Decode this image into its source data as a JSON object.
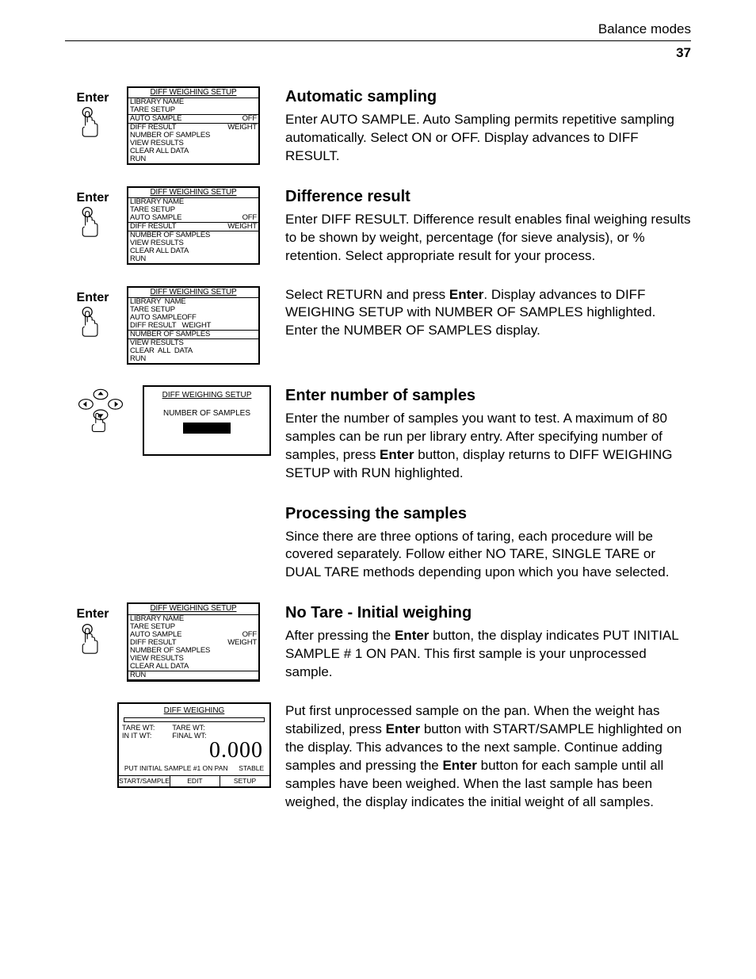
{
  "header": {
    "section": "Balance modes",
    "page": "37"
  },
  "enterLabel": "Enter",
  "sections": [
    {
      "heading": "Automatic sampling",
      "body": "Enter AUTO SAMPLE. Auto Sampling permits repetitive sampling automatically. Select ON or OFF. Display advances to DIFF RESULT."
    },
    {
      "heading": "Difference result",
      "body": "Enter DIFF RESULT. Difference result enables final weighing results to be shown by weight, percentage (for sieve analysis), or % retention. Select appropriate result for your process."
    },
    {
      "heading": "",
      "body_pre": "Select RETURN and press ",
      "body_bold": "Enter",
      "body_post": ". Display advances to DIFF WEIGHING SETUP with NUMBER OF SAMPLES highlighted. Enter the NUMBER OF SAMPLES display."
    },
    {
      "heading": "Enter number of samples",
      "body_pre": "Enter the number of samples you want to test. A maximum of 80 samples can be run per library entry. After specifying number of samples, press ",
      "body_bold": "Enter",
      "body_post": " button, display returns to DIFF WEIGHING SETUP with RUN highlighted."
    },
    {
      "heading": "Processing the samples",
      "body": "Since there are three options of taring, each procedure will be covered separately. Follow either NO TARE, SINGLE TARE or DUAL TARE methods depending upon which you have selected."
    },
    {
      "heading": "No Tare - Initial weighing",
      "body_pre": "After pressing the ",
      "body_bold": "Enter",
      "body_post": " button, the display indicates PUT INITIAL SAMPLE # 1 ON PAN. This first sample is your unprocessed sample."
    },
    {
      "heading": "",
      "body_parts": [
        "Put first unprocessed sample on the pan. When the weight has stabilized, press ",
        "Enter",
        " button with START/SAMPLE highlighted on the display. This advances to the next sample. Continue adding samples and pressing the ",
        "Enter",
        " button for each sample until all samples have been weighed. When the last sample has been weighed, the display indicates the initial weight of all samples."
      ]
    }
  ],
  "screens": {
    "title": "DIFF WEIGHING SETUP",
    "menu1": {
      "lines": [
        {
          "l": "LIBRARY NAME"
        },
        {
          "l": "TARE SETUP"
        },
        {
          "l": "AUTO SAMPLE",
          "r": "OFF",
          "sel": true
        },
        {
          "l": "DIFF RESULT",
          "r": "WEIGHT"
        },
        {
          "l": "NUMBER OF SAMPLES"
        },
        {
          "l": "VIEW RESULTS"
        },
        {
          "l": "CLEAR ALL DATA"
        },
        {
          "l": "RUN"
        }
      ]
    },
    "menu2": {
      "lines": [
        {
          "l": "LIBRARY NAME"
        },
        {
          "l": "TARE SETUP"
        },
        {
          "l": "AUTO SAMPLE",
          "r": "OFF"
        },
        {
          "l": "DIFF RESULT",
          "r": "WEIGHT",
          "sel": true
        },
        {
          "l": "NUMBER OF SAMPLES"
        },
        {
          "l": "VIEW RESULTS"
        },
        {
          "l": "CLEAR ALL DATA"
        },
        {
          "l": "RUN"
        }
      ]
    },
    "menu3": {
      "lines": [
        {
          "l": "LIBRARY  NAME"
        },
        {
          "l": "TARE SETUP"
        },
        {
          "l": "AUTO SAMPLEOFF"
        },
        {
          "l": "DIFF RESULT   WEIGHT"
        },
        {
          "l": "NUMBER OF SAMPLES",
          "sel": true
        },
        {
          "l": "VIEW RESULTS"
        },
        {
          "l": "CLEAR  ALL  DATA"
        },
        {
          "l": "RUN"
        }
      ]
    },
    "numEntry": {
      "title": "DIFF WEIGHING SETUP",
      "label": "NUMBER OF SAMPLES"
    },
    "menu5": {
      "lines": [
        {
          "l": "LIBRARY NAME"
        },
        {
          "l": "TARE SETUP"
        },
        {
          "l": "AUTO SAMPLE",
          "r": "OFF"
        },
        {
          "l": "DIFF RESULT",
          "r": "WEIGHT"
        },
        {
          "l": "NUMBER OF SAMPLES"
        },
        {
          "l": "VIEW RESULTS"
        },
        {
          "l": "CLEAR ALL DATA"
        },
        {
          "l": "RUN",
          "sel": true
        }
      ]
    },
    "weigh": {
      "title": "DIFF WEIGHING",
      "left": [
        "TARE WT:",
        "IN IT WT:"
      ],
      "right": [
        "TARE WT:",
        "FINAL WT:"
      ],
      "reading": "0.000",
      "msgL": "PUT INITIAL SAMPLE #1 ON PAN",
      "msgR": "STABLE",
      "buttons": [
        "START/SAMPLE",
        "EDIT",
        "SETUP"
      ]
    }
  }
}
